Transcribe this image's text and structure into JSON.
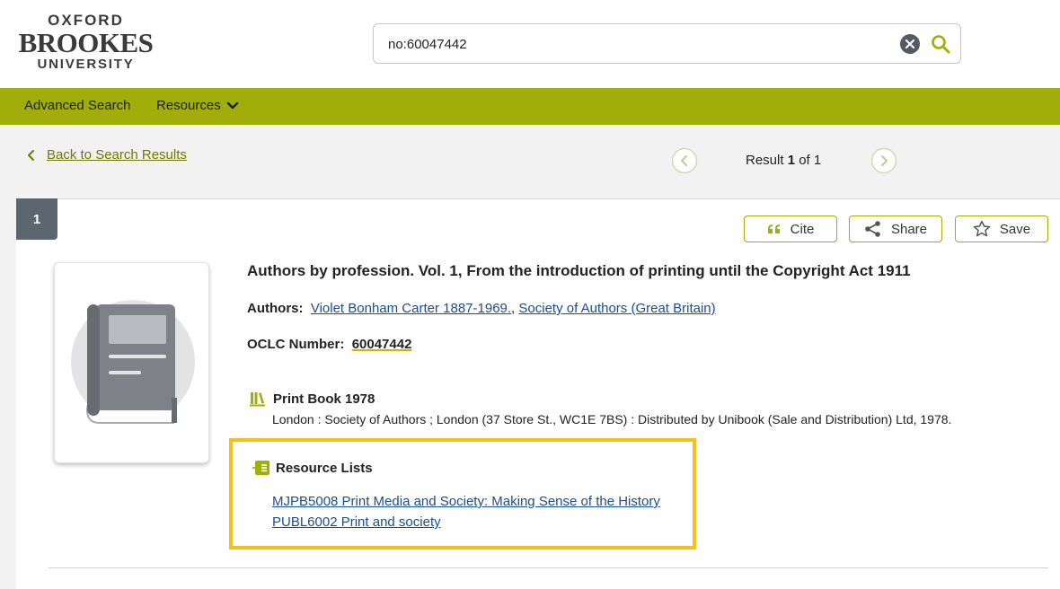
{
  "logo": {
    "line1": "OXFORD",
    "line2": "BROOKES",
    "line3": "UNIVERSITY"
  },
  "search": {
    "value": "no:60047442"
  },
  "nav": {
    "advanced_search": "Advanced Search",
    "resources": "Resources"
  },
  "back_link": "Back to Search Results",
  "pager": {
    "prefix": "Result ",
    "current": "1",
    "suffix": " of 1"
  },
  "record": {
    "number": "1",
    "actions": {
      "cite": "Cite",
      "share": "Share",
      "save": "Save"
    },
    "title": "Authors by profession. Vol. 1, From the introduction of printing until the Copyright Act 1911",
    "authors_label": "Authors:",
    "authors": [
      {
        "name": "Violet Bonham Carter 1887-1969."
      },
      {
        "name": "Society of Authors (Great Britain)"
      }
    ],
    "authors_sep": ",",
    "oclc_label": "OCLC Number:",
    "oclc_value": "60047442",
    "format": "Print Book 1978",
    "publication": "London : Society of Authors ; London (37 Store St., WC1E 7BS) : Distributed by Unibook (Sale and Distribution) Ltd, 1978.",
    "resource_lists_label": "Resource Lists",
    "resource_lists": [
      "MJPB5008 Print Media and Society: Making Sense of the History",
      "PUBL6002 Print and society"
    ]
  },
  "colors": {
    "brand_green": "#a1ae0a",
    "link_blue": "#1a4e8c",
    "highlight_yellow": "#f2c21b",
    "badge_grey": "#5c6670"
  },
  "icons": [
    "clear-icon",
    "search-icon",
    "chevron-down-icon",
    "chevron-left-icon",
    "chevron-right-icon",
    "quote-icon",
    "share-icon",
    "star-icon",
    "book-icon",
    "books-icon",
    "resource-list-icon"
  ]
}
